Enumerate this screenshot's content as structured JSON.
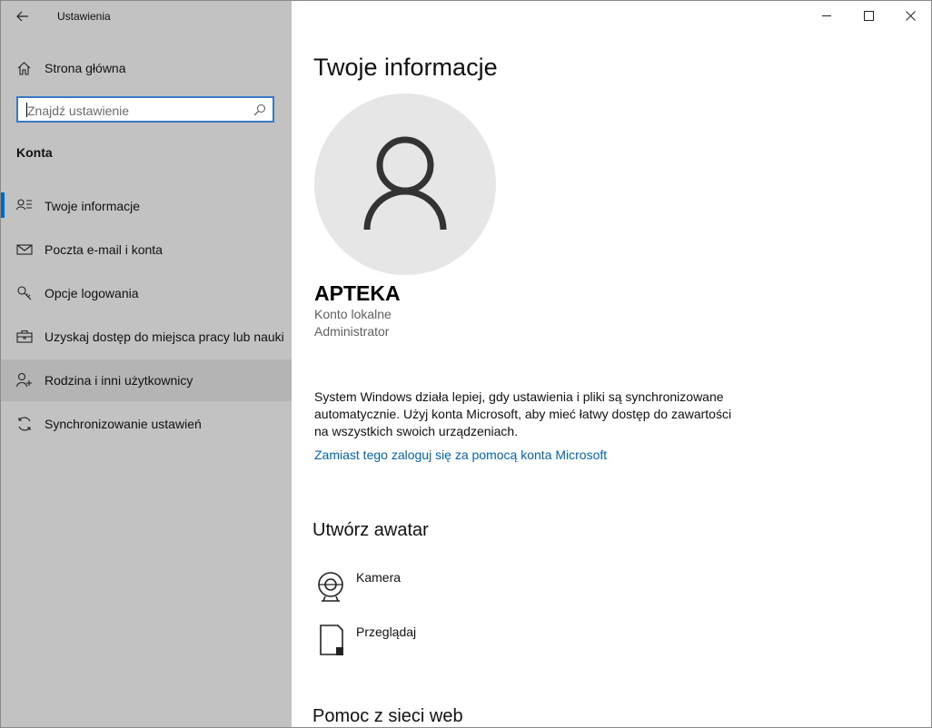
{
  "window": {
    "title": "Ustawienia"
  },
  "sidebar": {
    "home_label": "Strona główna",
    "search_placeholder": "Znajdź ustawienie",
    "section_label": "Konta",
    "items": [
      {
        "label": "Twoje informacje",
        "icon": "person-list-icon",
        "selected": true
      },
      {
        "label": "Poczta e-mail i konta",
        "icon": "mail-icon"
      },
      {
        "label": "Opcje logowania",
        "icon": "key-icon"
      },
      {
        "label": "Uzyskaj dostęp do miejsca pracy lub nauki",
        "icon": "briefcase-icon"
      },
      {
        "label": "Rodzina i inni użytkownicy",
        "icon": "person-add-icon",
        "hover": true
      },
      {
        "label": "Synchronizowanie ustawień",
        "icon": "sync-icon"
      }
    ]
  },
  "main": {
    "title": "Twoje informacje",
    "user_name": "APTEKA",
    "account_type": "Konto lokalne",
    "role": "Administrator",
    "info_text": "System Windows działa lepiej, gdy ustawienia i pliki są synchronizowane automatycznie. Użyj konta Microsoft, aby mieć łatwy dostęp do zawartości na wszystkich swoich urządzeniach.",
    "ms_link": "Zamiast tego zaloguj się za pomocą konta Microsoft",
    "avatar_section": "Utwórz awatar",
    "avatar_options": [
      {
        "label": "Kamera",
        "icon": "camera-icon"
      },
      {
        "label": "Przeglądaj",
        "icon": "browse-file-icon"
      }
    ],
    "web_help": "Pomoc z sieci web"
  },
  "colors": {
    "sidebar_bg": "#c2c2c2",
    "accent": "#0067c0",
    "link": "#0066b4"
  }
}
